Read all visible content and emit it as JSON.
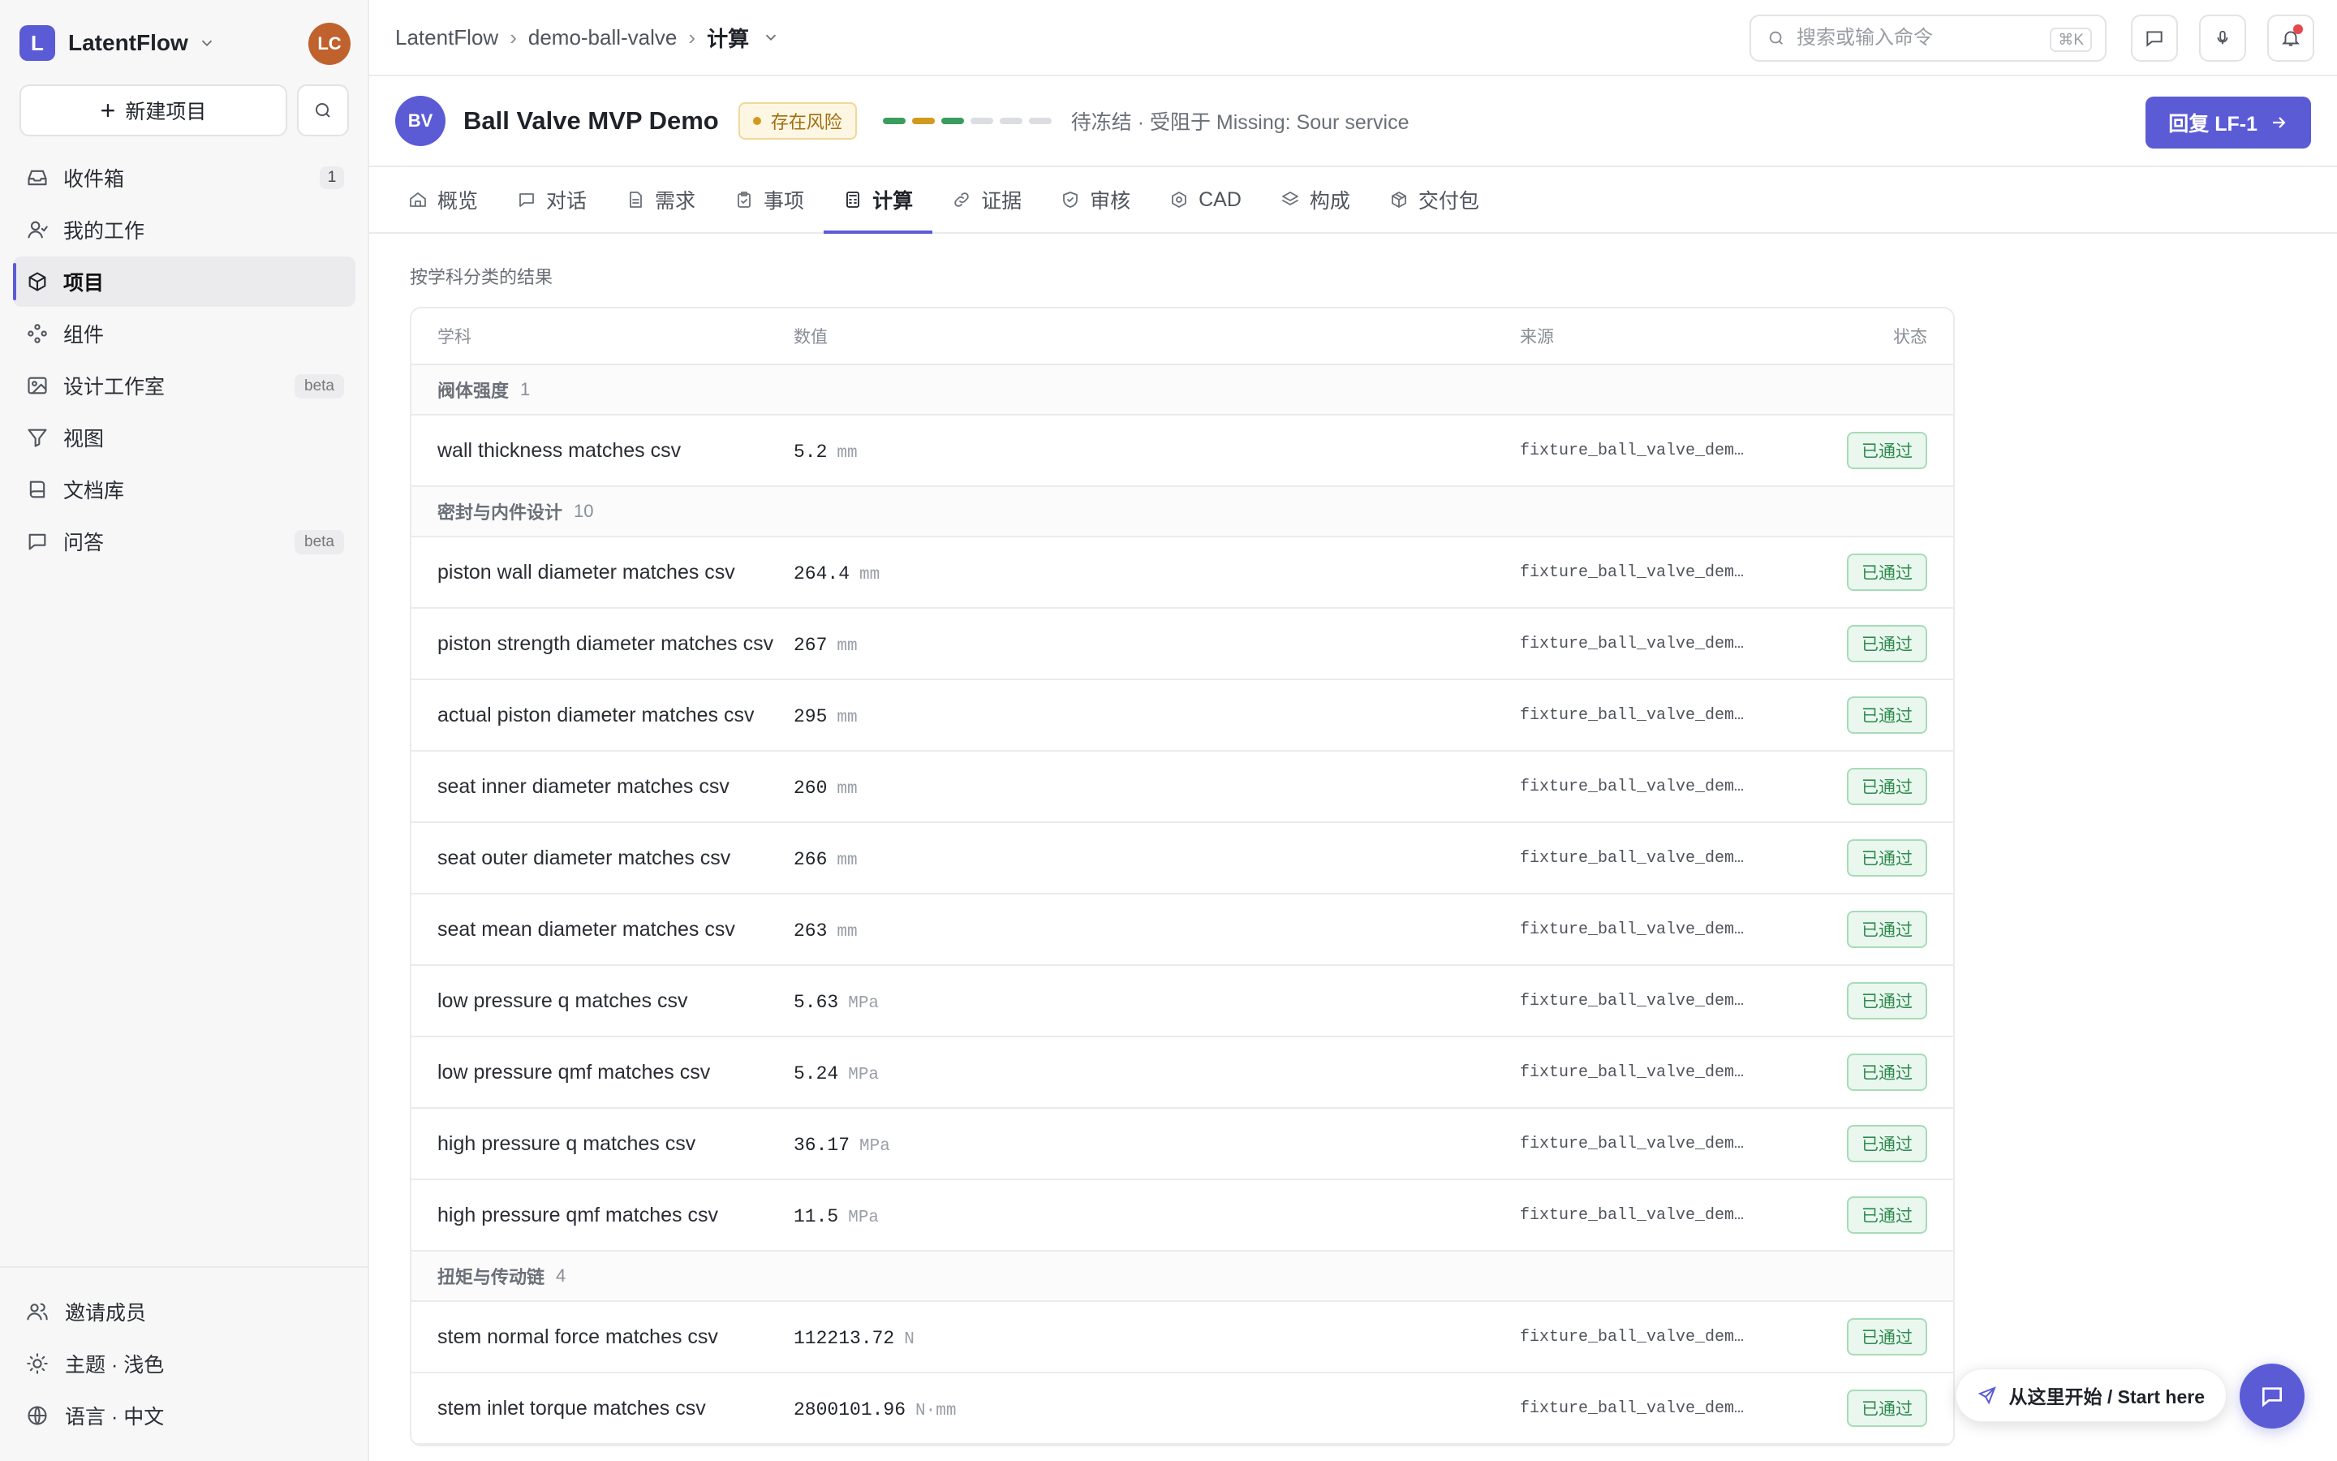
{
  "workspace": {
    "initial": "L",
    "name": "LatentFlow",
    "user_initials": "LC"
  },
  "sidebar": {
    "new_project_label": "新建项目",
    "items": [
      {
        "label": "收件箱",
        "icon": "inbox-icon",
        "badge": "1"
      },
      {
        "label": "我的工作",
        "icon": "user-icon"
      },
      {
        "label": "项目",
        "icon": "cube-icon",
        "active": true
      },
      {
        "label": "组件",
        "icon": "components-icon"
      },
      {
        "label": "设计工作室",
        "icon": "image-icon",
        "beta": "beta"
      },
      {
        "label": "视图",
        "icon": "filter-icon"
      },
      {
        "label": "文档库",
        "icon": "book-icon"
      },
      {
        "label": "问答",
        "icon": "chat-icon",
        "beta": "beta"
      }
    ],
    "bottom": [
      {
        "label": "邀请成员",
        "icon": "users-icon"
      },
      {
        "label": "主题 · 浅色",
        "icon": "sun-icon"
      },
      {
        "label": "语言 · 中文",
        "icon": "globe-icon"
      }
    ]
  },
  "breadcrumb": [
    "LatentFlow",
    "demo-ball-valve",
    "计算"
  ],
  "search": {
    "placeholder": "搜索或输入命令",
    "shortcut": "⌘K"
  },
  "project": {
    "initials": "BV",
    "title": "Ball Valve MVP Demo",
    "risk_label": "存在风险",
    "progress": [
      "#3a9d5d",
      "#d19a1f",
      "#3a9d5d",
      "#dcdde1",
      "#dcdde1",
      "#dcdde1"
    ],
    "status": "待冻结 · 受阻于 Missing: Sour service",
    "reply_label": "回复 LF-1"
  },
  "tabs": [
    {
      "label": "概览",
      "icon": "home-icon"
    },
    {
      "label": "对话",
      "icon": "message-icon"
    },
    {
      "label": "需求",
      "icon": "document-icon"
    },
    {
      "label": "事项",
      "icon": "clipboard-icon"
    },
    {
      "label": "计算",
      "icon": "calculator-icon",
      "active": true
    },
    {
      "label": "证据",
      "icon": "link-icon"
    },
    {
      "label": "审核",
      "icon": "shield-icon"
    },
    {
      "label": "CAD",
      "icon": "cad-icon"
    },
    {
      "label": "构成",
      "icon": "layers-icon"
    },
    {
      "label": "交付包",
      "icon": "package-icon"
    }
  ],
  "results": {
    "section_title": "按学科分类的结果",
    "columns": [
      "学科",
      "数值",
      "来源",
      "状态"
    ],
    "groups": [
      {
        "name": "阀体强度",
        "count": "1",
        "rows": [
          {
            "name": "wall thickness matches csv",
            "value": "5.2",
            "unit": "mm",
            "source": "fixture_ball_valve_dem…",
            "status": "已通过"
          }
        ]
      },
      {
        "name": "密封与内件设计",
        "count": "10",
        "rows": [
          {
            "name": "piston wall diameter matches csv",
            "value": "264.4",
            "unit": "mm",
            "source": "fixture_ball_valve_dem…",
            "status": "已通过"
          },
          {
            "name": "piston strength diameter matches csv",
            "value": "267",
            "unit": "mm",
            "source": "fixture_ball_valve_dem…",
            "status": "已通过"
          },
          {
            "name": "actual piston diameter matches csv",
            "value": "295",
            "unit": "mm",
            "source": "fixture_ball_valve_dem…",
            "status": "已通过"
          },
          {
            "name": "seat inner diameter matches csv",
            "value": "260",
            "unit": "mm",
            "source": "fixture_ball_valve_dem…",
            "status": "已通过"
          },
          {
            "name": "seat outer diameter matches csv",
            "value": "266",
            "unit": "mm",
            "source": "fixture_ball_valve_dem…",
            "status": "已通过"
          },
          {
            "name": "seat mean diameter matches csv",
            "value": "263",
            "unit": "mm",
            "source": "fixture_ball_valve_dem…",
            "status": "已通过"
          },
          {
            "name": "low pressure q matches csv",
            "value": "5.63",
            "unit": "MPa",
            "source": "fixture_ball_valve_dem…",
            "status": "已通过"
          },
          {
            "name": "low pressure qmf matches csv",
            "value": "5.24",
            "unit": "MPa",
            "source": "fixture_ball_valve_dem…",
            "status": "已通过"
          },
          {
            "name": "high pressure q matches csv",
            "value": "36.17",
            "unit": "MPa",
            "source": "fixture_ball_valve_dem…",
            "status": "已通过"
          },
          {
            "name": "high pressure qmf matches csv",
            "value": "11.5",
            "unit": "MPa",
            "source": "fixture_ball_valve_dem…",
            "status": "已通过"
          }
        ]
      },
      {
        "name": "扭矩与传动链",
        "count": "4",
        "rows": [
          {
            "name": "stem normal force matches csv",
            "value": "112213.72",
            "unit": "N",
            "source": "fixture_ball_valve_dem…",
            "status": "已通过"
          },
          {
            "name": "stem inlet torque matches csv",
            "value": "2800101.96",
            "unit": "N·mm",
            "source": "fixture_ball_valve_dem…",
            "status": "已通过"
          }
        ]
      }
    ]
  },
  "start_here_label": "从这里开始 / Start here"
}
